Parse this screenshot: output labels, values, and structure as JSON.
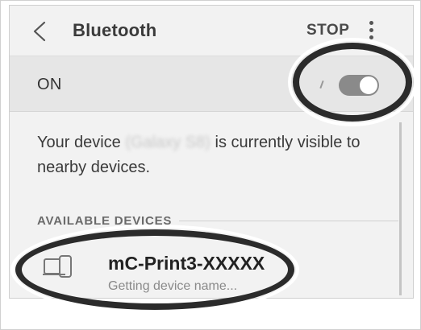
{
  "header": {
    "back_icon": "chevron-left-icon",
    "title": "Bluetooth",
    "stop_label": "STOP",
    "more_icon": "more-vertical-icon"
  },
  "bluetooth_toggle": {
    "label": "ON",
    "state": "on"
  },
  "visibility": {
    "prefix": "Your device ",
    "device_name_blurred": "(Galaxy S8)",
    "suffix": " is currently visible to nearby devices."
  },
  "available_devices": {
    "header": "AVAILABLE DEVICES",
    "items": [
      {
        "icon": "device-icon",
        "name": "mC-Print3-XXXXX",
        "status": "Getting device name..."
      }
    ]
  },
  "colors": {
    "background": "#f2f2f2",
    "toggle_track": "#8a8a8a",
    "annotation": "#2b2b2b"
  }
}
